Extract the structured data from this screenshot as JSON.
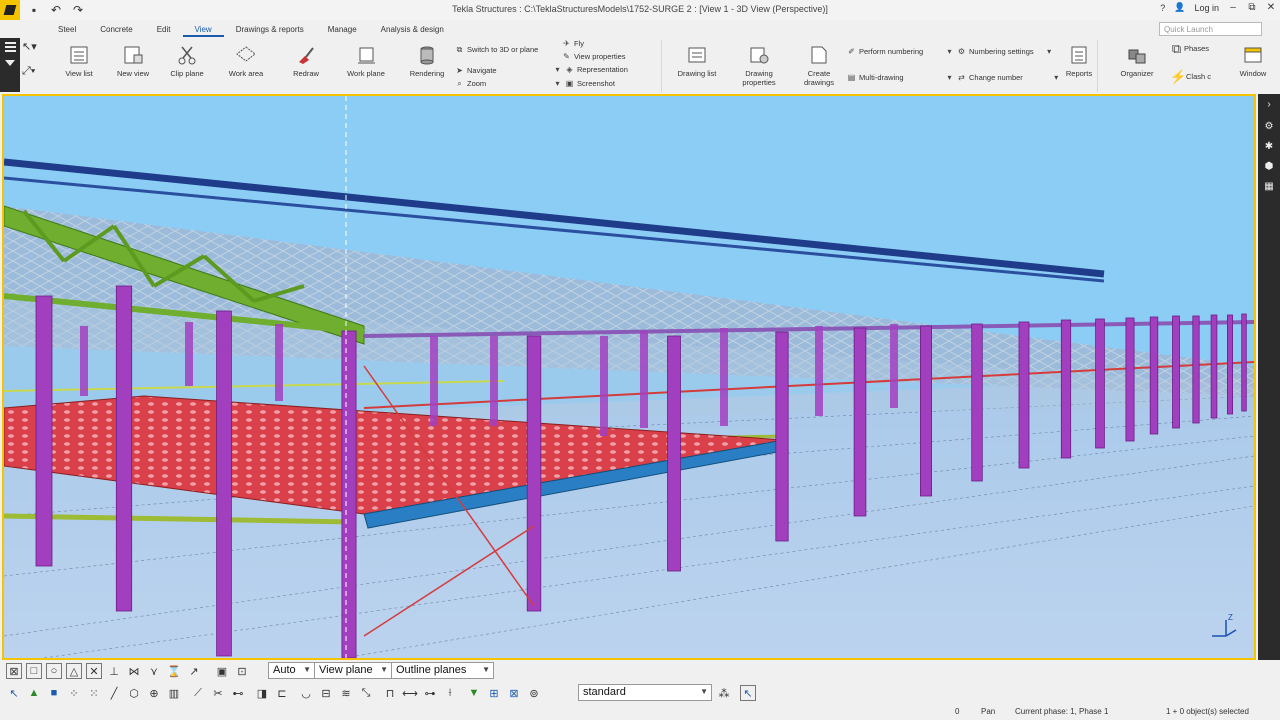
{
  "titlebar": {
    "title": "Tekla Structures : C:\\TeklaStructuresModels\\1752-SURGE 2  : [View 1 - 3D View (Perspective)]",
    "help": "?",
    "login": "Log in",
    "minimize": "–",
    "restore": "⧉",
    "close": "✕"
  },
  "menu": {
    "tabs": [
      "Steel",
      "Concrete",
      "Edit",
      "View",
      "Drawings & reports",
      "Manage",
      "Analysis & design"
    ],
    "active": "View",
    "quick_launch_placeholder": "Quick Launch"
  },
  "ribbon": {
    "view_list": "View list",
    "new_view": "New view",
    "clip_plane": "Clip plane",
    "work_area": "Work area",
    "redraw": "Redraw",
    "work_plane": "Work plane",
    "rendering": "Rendering",
    "switch_3d": "Switch to 3D or plane",
    "navigate": "Navigate",
    "zoom": "Zoom",
    "fly": "Fly",
    "view_properties": "View properties",
    "representation": "Representation",
    "screenshot": "Screenshot",
    "drawing_list": "Drawing list",
    "drawing_properties": "Drawing properties",
    "create_drawings": "Create drawings",
    "perform_numbering": "Perform numbering",
    "multi_drawing": "Multi-drawing",
    "numbering_settings": "Numbering settings",
    "change_number": "Change number",
    "reports": "Reports",
    "organizer": "Organizer",
    "phases": "Phases",
    "clash": "Clash c",
    "window": "Window"
  },
  "toolbar": {
    "snap_mode": "Auto",
    "plane_mode": "View plane",
    "planes_display": "Outline planes",
    "filter": "standard"
  },
  "status": {
    "coord": "0",
    "mode": "Pan",
    "phase": "Current phase: 1, Phase 1",
    "selection": "1 + 0 object(s) selected"
  },
  "colors": {
    "accent": "#f5c400",
    "sky": "#8ccdf6",
    "column": "#a23fbf",
    "truss": "#6fae2e",
    "deck": "#d9404a",
    "beam_blue": "#2a7fc4",
    "rafter_dark": "#1e3c8a"
  }
}
